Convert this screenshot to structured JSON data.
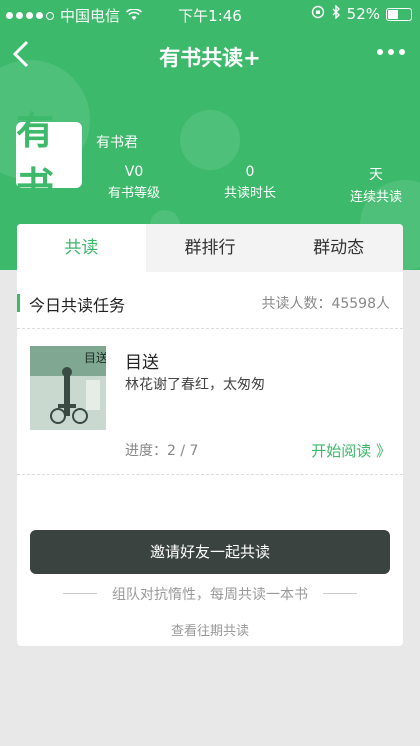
{
  "status_bar": {
    "carrier": "中国电信",
    "time": "下午1:46",
    "battery": "52%",
    "battery_level": 0.52
  },
  "nav": {
    "title": "有书共读+",
    "back_icon": "chevron-left-icon",
    "more_icon": "more-dots-icon"
  },
  "profile": {
    "logo_text": "有书",
    "username": "有书君",
    "stats": [
      {
        "value": "V0",
        "label": "有书等级"
      },
      {
        "value": "0",
        "label": "共读时长"
      },
      {
        "value": "天",
        "label": "连续共读"
      }
    ]
  },
  "tabs": [
    {
      "label": "共读",
      "active": true
    },
    {
      "label": "群排行",
      "active": false
    },
    {
      "label": "群动态",
      "active": false
    }
  ],
  "task": {
    "title": "今日共读任务",
    "count": "共读人数：45598人"
  },
  "book": {
    "title": "目送",
    "subtitle": "林花谢了春红，太匆匆",
    "progress": "进度：2 / 7",
    "start": "开始阅读 》",
    "cover_text": "目送"
  },
  "invite_button": "邀请好友一起共读",
  "slogan": "组队对抗惰性，每周共读一本书",
  "history_link": "查看往期共读",
  "colors": {
    "brand_green": "#3cb96a",
    "button_dark": "#3a4340"
  }
}
